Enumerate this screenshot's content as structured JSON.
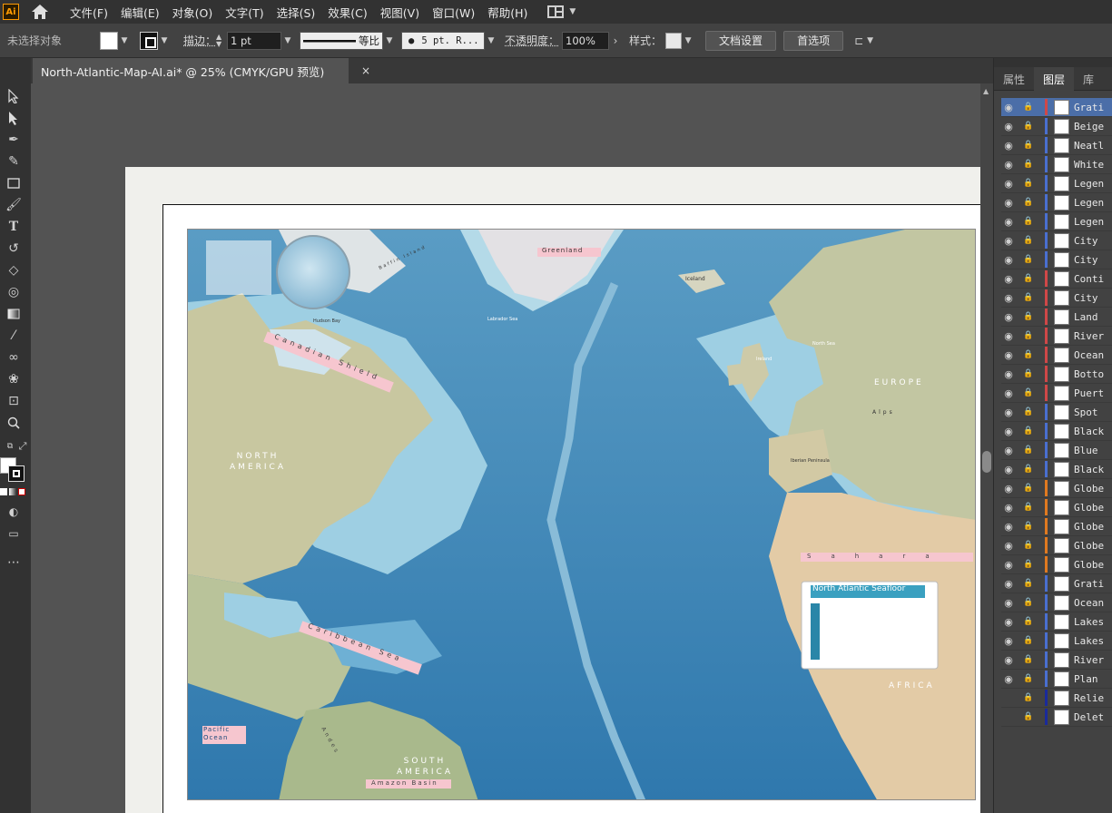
{
  "app": {
    "logo_text": "Ai"
  },
  "menu": {
    "items": [
      {
        "id": "file",
        "label": "文件(F)"
      },
      {
        "id": "edit",
        "label": "编辑(E)"
      },
      {
        "id": "object",
        "label": "对象(O)"
      },
      {
        "id": "type",
        "label": "文字(T)"
      },
      {
        "id": "select",
        "label": "选择(S)"
      },
      {
        "id": "effect",
        "label": "效果(C)"
      },
      {
        "id": "view",
        "label": "视图(V)"
      },
      {
        "id": "window",
        "label": "窗口(W)"
      },
      {
        "id": "help",
        "label": "帮助(H)"
      }
    ]
  },
  "control": {
    "selection_status": "未选择对象",
    "stroke_label": "描边：",
    "stroke_weight": "1 pt",
    "stroke_profile": "等比",
    "brush": "5 pt. R...",
    "opacity_label": "不透明度：",
    "opacity_value": "100%",
    "style_label": "样式：",
    "doc_setup_button": "文档设置",
    "preferences_button": "首选项"
  },
  "document": {
    "tab_title": "North-Atlantic-Map-AI.ai* @ 25% (CMYK/GPU 预览)",
    "close_glyph": "×"
  },
  "map": {
    "title": "North Atlantic Seafloor",
    "greenland": "Greenland",
    "iceland": "Iceland",
    "europe": "EUROPE",
    "north_america": "NORTH AMERICA",
    "south_america": "SOUTH AMERICA",
    "africa": "AFRICA",
    "sahara": "Sahara",
    "canadian_shield": "Canadian Shield",
    "pacific_ocean": "Pacific Ocean",
    "caribbean_sea": "Caribbean Sea",
    "amazon_basin": "Amazon Basin",
    "iberian_peninsula": "Iberian Peninsula",
    "hudson_bay": "Hudson Bay",
    "labrador_sea": "Labrador Sea",
    "alps": "Alps",
    "baffin_island": "Baffin Island",
    "ireland": "Ireland",
    "north_sea": "North Sea",
    "andes": "Andes",
    "colors": {
      "ocean_deep": "#2a74a8",
      "ocean_shelf": "#9ecfe3",
      "land": "#c8c7a0",
      "land_desert": "#e3cba6",
      "ice": "#dfe4e6",
      "label_pink": "#f6c6cf"
    }
  },
  "panel": {
    "tabs": [
      {
        "id": "properties",
        "label": "属性",
        "active": false
      },
      {
        "id": "layers",
        "label": "图层",
        "active": true
      },
      {
        "id": "libraries",
        "label": "库",
        "active": false
      }
    ],
    "layers": [
      {
        "name": "Grati",
        "visible": true,
        "color": "#d04848",
        "selected": true
      },
      {
        "name": "Beige",
        "visible": true,
        "color": "#4a6fd0"
      },
      {
        "name": "Neatl",
        "visible": true,
        "color": "#4a6fd0"
      },
      {
        "name": "White",
        "visible": true,
        "color": "#4a6fd0"
      },
      {
        "name": "Legen",
        "visible": true,
        "color": "#4a6fd0"
      },
      {
        "name": "Legen",
        "visible": true,
        "color": "#4a6fd0"
      },
      {
        "name": "Legen",
        "visible": true,
        "color": "#4a6fd0"
      },
      {
        "name": "City",
        "visible": true,
        "color": "#4a6fd0"
      },
      {
        "name": "City",
        "visible": true,
        "color": "#4a6fd0"
      },
      {
        "name": "Conti",
        "visible": true,
        "color": "#d04848"
      },
      {
        "name": "City",
        "visible": true,
        "color": "#d04848"
      },
      {
        "name": "Land",
        "visible": true,
        "color": "#d04848"
      },
      {
        "name": "River",
        "visible": true,
        "color": "#d04848"
      },
      {
        "name": "Ocean",
        "visible": true,
        "color": "#d04848"
      },
      {
        "name": "Botto",
        "visible": true,
        "color": "#d04848"
      },
      {
        "name": "Puert",
        "visible": true,
        "color": "#d04848"
      },
      {
        "name": "Spot",
        "visible": true,
        "color": "#4a6fd0"
      },
      {
        "name": "Black",
        "visible": true,
        "color": "#4a6fd0"
      },
      {
        "name": "Blue",
        "visible": true,
        "color": "#4a6fd0"
      },
      {
        "name": "Black",
        "visible": true,
        "color": "#4a6fd0"
      },
      {
        "name": "Globe",
        "visible": true,
        "color": "#e07a20"
      },
      {
        "name": "Globe",
        "visible": true,
        "color": "#e07a20"
      },
      {
        "name": "Globe",
        "visible": true,
        "color": "#e07a20"
      },
      {
        "name": "Globe",
        "visible": true,
        "color": "#e07a20"
      },
      {
        "name": "Globe",
        "visible": true,
        "color": "#e07a20"
      },
      {
        "name": "Grati",
        "visible": true,
        "color": "#4a6fd0"
      },
      {
        "name": "Ocean",
        "visible": true,
        "color": "#4a6fd0"
      },
      {
        "name": "Lakes",
        "visible": true,
        "color": "#4a6fd0"
      },
      {
        "name": "Lakes",
        "visible": true,
        "color": "#4a6fd0"
      },
      {
        "name": "River",
        "visible": true,
        "color": "#4a6fd0"
      },
      {
        "name": "Plan",
        "visible": true,
        "color": "#4a6fd0"
      },
      {
        "name": "Relie",
        "visible": false,
        "color": "#1a2a9a"
      },
      {
        "name": "Delet",
        "visible": false,
        "color": "#1a2a9a"
      }
    ]
  }
}
